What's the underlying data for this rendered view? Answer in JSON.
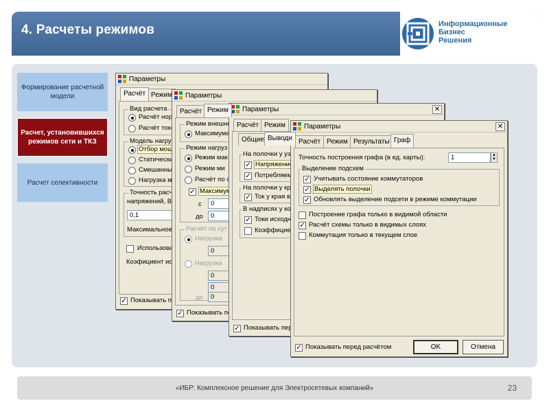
{
  "slide": {
    "title": "4. Расчеты режимов",
    "logo": {
      "line1": "Информационные",
      "line2": "Бизнес",
      "line3": "Решения"
    },
    "footer": "«ИБР: Комплексное решение для Электросетевых компаний»",
    "page_number": "23"
  },
  "sidebar": {
    "items": [
      {
        "label": "Формирование расчетной модели"
      },
      {
        "label": "Расчет, установившихся режимов сети и ТКЗ"
      },
      {
        "label": "Расчет селективности"
      }
    ]
  },
  "dialog_title": "Параметры",
  "w1": {
    "tabs": [
      "Расчёт",
      "Режим"
    ],
    "g_vid": "Вид расчета",
    "r_norm": "Расчёт норм",
    "r_tok": "Расчёт токо",
    "g_model": "Модель нагрузк",
    "r_otbor": "Отбор мощн",
    "r_stat": "Статически",
    "r_smesh": "Смешанный",
    "r_nagr": "Нагрузка мо",
    "g_toch": "Точность расчё",
    "toch_line": "напряжений, В:",
    "toch_value": "0,1",
    "max_lbl": "Максимальное",
    "ispolz": "Использоват",
    "koef": "Коэфициент испо",
    "show": "Показывать пе"
  },
  "w2": {
    "tabs": [
      "Расчёт",
      "Режим"
    ],
    "g_vnesh": "Режим внешне",
    "r_maxim": "Максимума",
    "g_nagr": "Режим нагруз",
    "r_mak": "Режим мак",
    "r_min": "Режим ми",
    "r_po": "Расчёт по с",
    "c_maxim": "Максимум",
    "s_lbl": "с",
    "s_val": "0",
    "do_lbl": "до",
    "do_val": "0",
    "g_sut": "Расчёт по сут",
    "nagr1": "Нагрузка",
    "nagr2": "Нагрузка",
    "g1": "0",
    "g2": "0",
    "g3": "0",
    "g_do_lbl": "до",
    "g4": "0",
    "show": "Показывать пе"
  },
  "w3": {
    "tabs": [
      "Общие",
      "Выводи"
    ],
    "g_polochki": "На полочки у уз",
    "napr": "Напряжение",
    "potreb": "Потребляем",
    "g_polochki2": "На полочки у кр",
    "tok": "Ток у края в",
    "g_nadpisi": "В надписях у ко",
    "toki": "Токи исходн",
    "koef": "Коэффициен",
    "show": "Показывать пер"
  },
  "w4": {
    "tabs": [
      "Расчёт",
      "Режим",
      "Результаты",
      "Граф"
    ],
    "accuracy_label": "Точность построения графа (в ед. карты):",
    "accuracy_value": "1",
    "group_label": "Выделение подсхем",
    "chk1": "Учитывать состояние коммутаторов",
    "chk2": "Выделять полочки",
    "chk3": "Обновлять выделение подсети в режиме коммутации",
    "opt1": "Построение графа только в видимой области",
    "opt2": "Расчёт схемы только в видимых слоях",
    "opt3": "Коммутация только в текущем слое",
    "show_before": "Показывать перед расчётом",
    "ok": "OK",
    "cancel": "Отмена"
  },
  "colors": {
    "title_bar": "#4a6fa0",
    "active_item": "#8a0d12",
    "sidebar_item": "#a8c8ea",
    "content_bg": "#dfe4ea",
    "dialog_bg": "#ece9d8",
    "logo_text": "#2e6aa6"
  },
  "icons": {
    "dialog": "params-app-icon",
    "close": "close-icon",
    "logo": "company-logo-mark"
  }
}
